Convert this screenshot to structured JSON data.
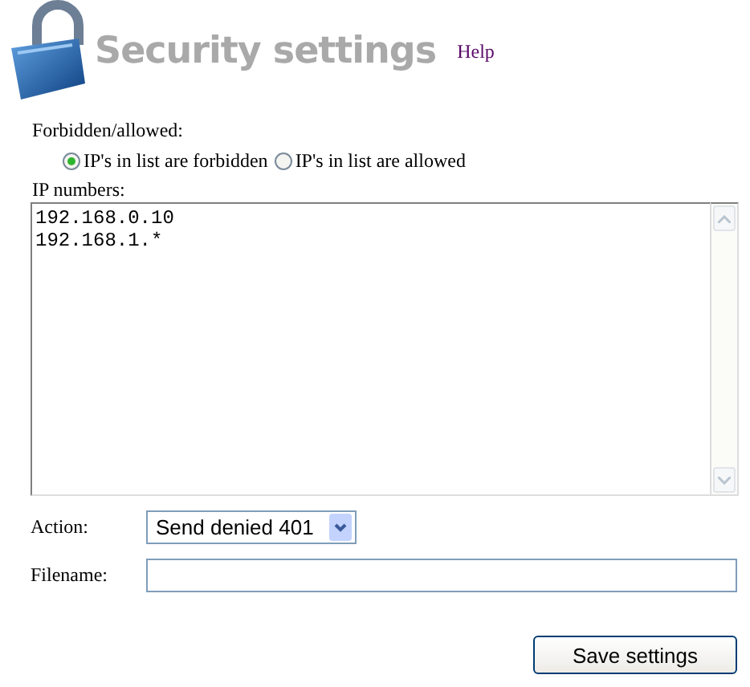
{
  "header": {
    "title": "Security settings",
    "help_link": "Help"
  },
  "mode": {
    "label": "Forbidden/allowed:",
    "options": [
      {
        "label": "IP's in list are forbidden",
        "selected": true
      },
      {
        "label": "IP's in list are allowed",
        "selected": false
      }
    ]
  },
  "ip_numbers": {
    "label": "IP numbers:",
    "value": "192.168.0.10\n192.168.1.*"
  },
  "action": {
    "label": "Action:",
    "value": "Send denied 401"
  },
  "filename": {
    "label": "Filename:"
  },
  "buttons": [
    "Save settings"
  ]
}
